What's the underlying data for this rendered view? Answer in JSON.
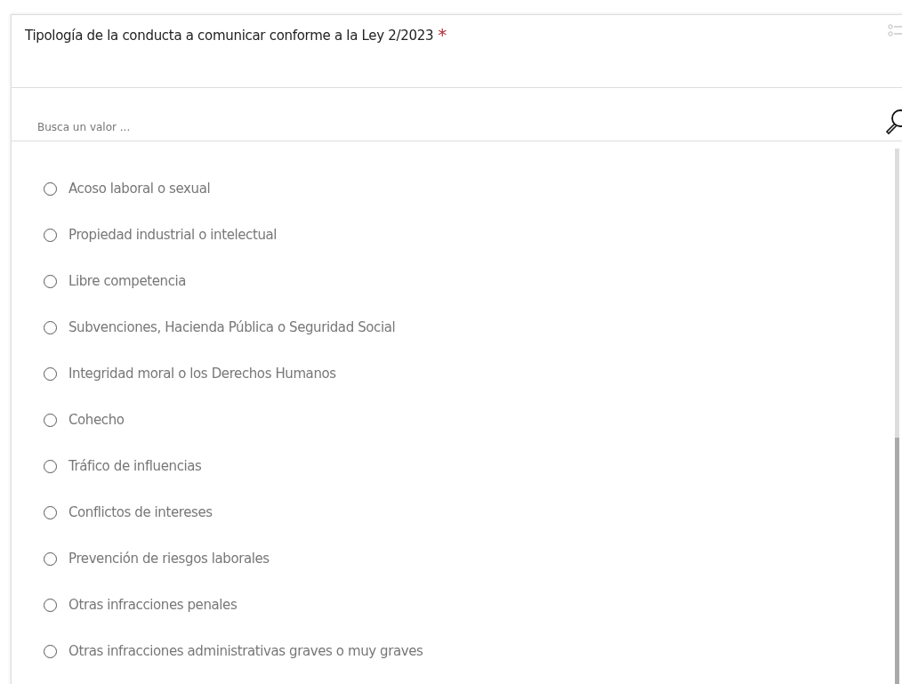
{
  "field": {
    "label": "Tipología de la conducta a comunicar conforme a la Ley 2/2023",
    "required_mark": "*"
  },
  "search": {
    "placeholder": "Busca un valor ..."
  },
  "options": [
    {
      "label": "Acoso laboral o sexual",
      "selected": false
    },
    {
      "label": "Propiedad industrial o intelectual",
      "selected": false
    },
    {
      "label": "Libre competencia",
      "selected": false
    },
    {
      "label": "Subvenciones, Hacienda Pública o Seguridad Social",
      "selected": false
    },
    {
      "label": "Integridad moral o los Derechos Humanos",
      "selected": false
    },
    {
      "label": "Cohecho",
      "selected": false
    },
    {
      "label": "Tráfico de influencias",
      "selected": false
    },
    {
      "label": "Conflictos de intereses",
      "selected": false
    },
    {
      "label": "Prevención de riesgos laborales",
      "selected": false
    },
    {
      "label": "Otras infracciones penales",
      "selected": false
    },
    {
      "label": "Otras infracciones administrativas graves o muy graves",
      "selected": false
    }
  ]
}
